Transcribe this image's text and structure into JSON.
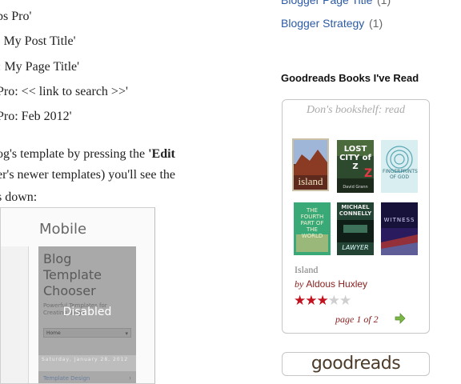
{
  "post": {
    "lines": [
      "ps Pro'",
      ": My Post Title'",
      ": My Page Title'",
      "Pro: << link to search >>'",
      "Pro: Feb 2012'",
      "og's template by pressing the ",
      "er's newer templates) you'll see the",
      "s down:"
    ],
    "edit_bold": "'Edit"
  },
  "screenshot": {
    "title": "Mobile",
    "panel_title": "Blog Template Chooser",
    "panel_sub": "Powerful Templates for Creating Blogs",
    "overlay": "Disabled",
    "home": "Home",
    "date": "Saturday, January 28, 2012",
    "link": "Template Design"
  },
  "sidebar": {
    "labels": [
      {
        "label": "Blogger Page Title",
        "count": "(1)"
      },
      {
        "label": "Blogger Strategy",
        "count": "(1)"
      }
    ]
  },
  "goodreads": {
    "heading": "Goodreads Books I've Read",
    "shelf": "Don's bookshelf: read",
    "books": [
      {
        "cover": "island",
        "label": "island"
      },
      {
        "cover": "lost-city-z",
        "label": "LOST CITY of Z"
      },
      {
        "cover": "fingerprints-of-god",
        "label": "FINGERPRINTS OF GOD"
      },
      {
        "cover": "fourth-part-of-the-world",
        "label": "THE FOURTH PART OF THE WORLD"
      },
      {
        "cover": "the-lawyer",
        "label": "MICHAEL CONNELLY"
      },
      {
        "cover": "the-witness",
        "label": "WITNESS"
      }
    ],
    "cover_subtitles": {
      "lost_city_author": "David Grann",
      "connelly_title": "LAWYER"
    },
    "selected": {
      "title": "Island",
      "by": "by",
      "author": "Aldous Huxley",
      "rating": 3,
      "max_rating": 5
    },
    "page": "page 1 of 2",
    "logo": "goodreads",
    "colors": {
      "star": "#c1121f",
      "author": "#8a1c1c",
      "link": "#2b5aa5"
    }
  }
}
